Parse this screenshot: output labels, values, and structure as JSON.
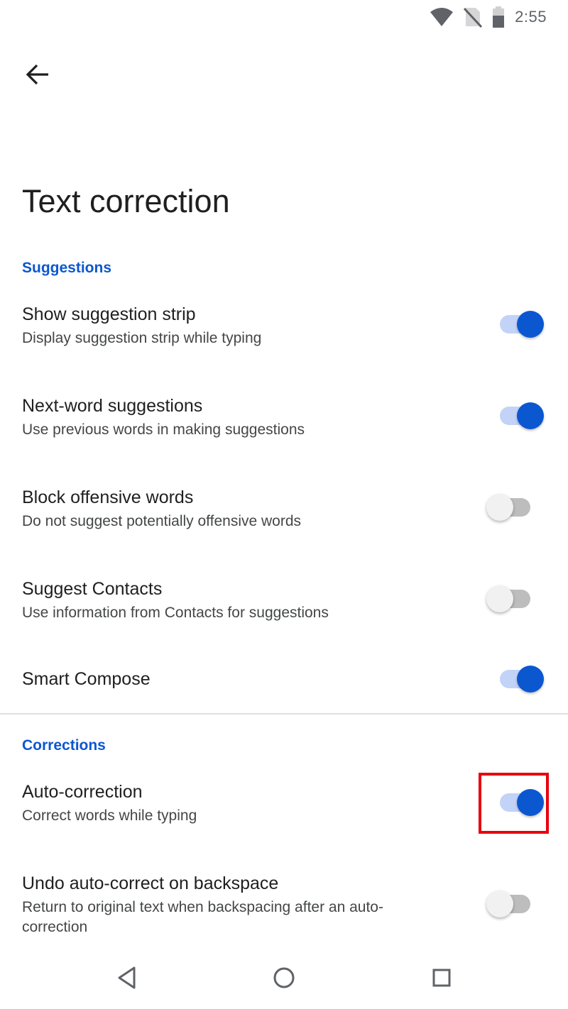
{
  "status_bar": {
    "time": "2:55",
    "icons": [
      "wifi-icon",
      "no-sim-icon",
      "battery-icon"
    ]
  },
  "page": {
    "title": "Text correction",
    "back_icon": "arrow-left-icon"
  },
  "sections": {
    "suggestions": {
      "header": "Suggestions",
      "items": [
        {
          "title": "Show suggestion strip",
          "description": "Display suggestion strip while typing",
          "enabled": true
        },
        {
          "title": "Next-word suggestions",
          "description": "Use previous words in making suggestions",
          "enabled": true
        },
        {
          "title": "Block offensive words",
          "description": "Do not suggest potentially offensive words",
          "enabled": false
        },
        {
          "title": "Suggest Contacts",
          "description": "Use information from Contacts for suggestions",
          "enabled": false
        },
        {
          "title": "Smart Compose",
          "enabled": true
        }
      ]
    },
    "corrections": {
      "header": "Corrections",
      "items": [
        {
          "title": "Auto-correction",
          "description": "Correct words while typing",
          "enabled": true
        },
        {
          "title": "Undo auto-correct on backspace",
          "description": "Return to original text when backspacing after an auto-correction",
          "enabled": false
        }
      ]
    }
  },
  "nav_bar": {
    "icons": [
      "back-triangle-icon",
      "home-circle-icon",
      "recents-square-icon"
    ]
  },
  "colors": {
    "accent": "#0b57d0",
    "highlight": "#e8000d"
  }
}
